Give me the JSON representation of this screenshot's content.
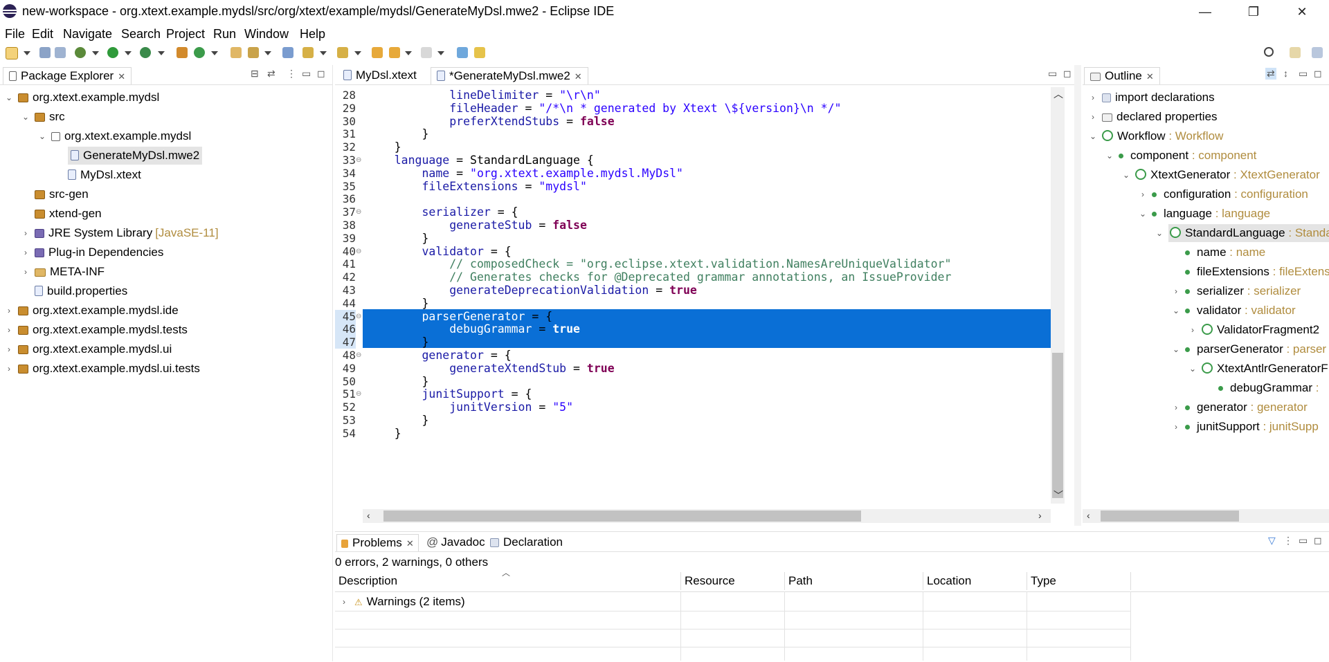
{
  "window": {
    "title": "new-workspace - org.xtext.example.mydsl/src/org/xtext/example/mydsl/GenerateMyDsl.mwe2 - Eclipse IDE",
    "minimize": "—",
    "restore": "❐",
    "close": "✕"
  },
  "menu": [
    "File",
    "Edit",
    "Navigate",
    "Search",
    "Project",
    "Run",
    "Window",
    "Help"
  ],
  "package_explorer": {
    "tab": "Package Explorer",
    "items": [
      {
        "label": "org.xtext.example.mydsl",
        "icon": "project-icon",
        "twisty": "⌄"
      },
      {
        "label": "src",
        "icon": "source-folder-icon",
        "twisty": "⌄"
      },
      {
        "label": "org.xtext.example.mydsl",
        "icon": "package-icon",
        "twisty": "⌄"
      },
      {
        "label": "GenerateMyDsl.mwe2",
        "icon": "mwe2-file-icon",
        "twisty": ""
      },
      {
        "label": "MyDsl.xtext",
        "icon": "xtext-file-icon",
        "twisty": ""
      },
      {
        "label": "src-gen",
        "icon": "source-folder-icon",
        "twisty": ""
      },
      {
        "label": "xtend-gen",
        "icon": "source-folder-icon",
        "twisty": ""
      },
      {
        "label": "JRE System Library",
        "suffix": "[JavaSE-11]",
        "icon": "library-icon",
        "twisty": "›"
      },
      {
        "label": "Plug-in Dependencies",
        "icon": "library-icon",
        "twisty": "›"
      },
      {
        "label": "META-INF",
        "icon": "folder-icon",
        "twisty": "›"
      },
      {
        "label": "build.properties",
        "icon": "properties-file-icon",
        "twisty": ""
      },
      {
        "label": "org.xtext.example.mydsl.ide",
        "icon": "project-icon",
        "twisty": "›"
      },
      {
        "label": "org.xtext.example.mydsl.tests",
        "icon": "project-icon",
        "twisty": "›"
      },
      {
        "label": "org.xtext.example.mydsl.ui",
        "icon": "project-icon",
        "twisty": "›"
      },
      {
        "label": "org.xtext.example.mydsl.ui.tests",
        "icon": "project-icon",
        "twisty": "›"
      }
    ]
  },
  "editor": {
    "tabs": [
      "MyDsl.xtext",
      "*GenerateMyDsl.mwe2"
    ],
    "lines": [
      {
        "n": "28",
        "text": "            lineDelimiter = \"\\r\\n\""
      },
      {
        "n": "29",
        "text": "            fileHeader = \"/*\\n * generated by Xtext \\${version}\\n */\""
      },
      {
        "n": "30",
        "text": "            preferXtendStubs = false"
      },
      {
        "n": "31",
        "text": "        }"
      },
      {
        "n": "32",
        "text": "    }"
      },
      {
        "n": "33",
        "text": "    language = StandardLanguage {"
      },
      {
        "n": "34",
        "text": "        name = \"org.xtext.example.mydsl.MyDsl\""
      },
      {
        "n": "35",
        "text": "        fileExtensions = \"mydsl\""
      },
      {
        "n": "36",
        "text": ""
      },
      {
        "n": "37",
        "text": "        serializer = {"
      },
      {
        "n": "38",
        "text": "            generateStub = false"
      },
      {
        "n": "39",
        "text": "        }"
      },
      {
        "n": "40",
        "text": "        validator = {"
      },
      {
        "n": "41",
        "text": "            // composedCheck = \"org.eclipse.xtext.validation.NamesAreUniqueValidator\""
      },
      {
        "n": "42",
        "text": "            // Generates checks for @Deprecated grammar annotations, an IssueProvider"
      },
      {
        "n": "43",
        "text": "            generateDeprecationValidation = true"
      },
      {
        "n": "44",
        "text": "        }"
      },
      {
        "n": "45",
        "text": "        parserGenerator = {"
      },
      {
        "n": "46",
        "text": "            debugGrammar = true"
      },
      {
        "n": "47",
        "text": "        }"
      },
      {
        "n": "48",
        "text": "        generator = {"
      },
      {
        "n": "49",
        "text": "            generateXtendStub = true"
      },
      {
        "n": "50",
        "text": "        }"
      },
      {
        "n": "51",
        "text": "        junitSupport = {"
      },
      {
        "n": "52",
        "text": "            junitVersion = \"5\""
      },
      {
        "n": "53",
        "text": "        }"
      },
      {
        "n": "54",
        "text": "    }"
      }
    ]
  },
  "outline": {
    "tab": "Outline",
    "items": [
      {
        "label": "import declarations",
        "type": "",
        "icon": "import-icon",
        "twisty": "›"
      },
      {
        "label": "declared properties",
        "type": "",
        "icon": "properties-icon",
        "twisty": "›"
      },
      {
        "label": "Workflow",
        "type": "Workflow",
        "icon": "component-icon",
        "twisty": "⌄"
      },
      {
        "label": "component",
        "type": "component",
        "icon": "property-dot-icon",
        "twisty": "⌄"
      },
      {
        "label": "XtextGenerator",
        "type": "XtextGenerator",
        "icon": "component-icon",
        "twisty": "⌄"
      },
      {
        "label": "configuration",
        "type": "configuration",
        "icon": "property-dot-icon",
        "twisty": "›"
      },
      {
        "label": "language",
        "type": "language",
        "icon": "property-dot-icon",
        "twisty": "⌄"
      },
      {
        "label": "StandardLanguage",
        "type": "Standa",
        "icon": "component-icon",
        "twisty": "⌄"
      },
      {
        "label": "name",
        "type": "name",
        "icon": "property-dot-icon",
        "twisty": ""
      },
      {
        "label": "fileExtensions",
        "type": "fileExtens",
        "icon": "property-dot-icon",
        "twisty": ""
      },
      {
        "label": "serializer",
        "type": "serializer",
        "icon": "property-dot-icon",
        "twisty": "›"
      },
      {
        "label": "validator",
        "type": "validator",
        "icon": "property-dot-icon",
        "twisty": "⌄"
      },
      {
        "label": "ValidatorFragment2",
        "type": "",
        "icon": "component-icon",
        "twisty": "›"
      },
      {
        "label": "parserGenerator",
        "type": "parser",
        "icon": "property-dot-icon",
        "twisty": "⌄"
      },
      {
        "label": "XtextAntlrGeneratorF",
        "type": "",
        "icon": "component-icon",
        "twisty": "⌄"
      },
      {
        "label": "debugGrammar",
        "type": ":",
        "icon": "property-dot-icon",
        "twisty": ""
      },
      {
        "label": "generator",
        "type": "generator",
        "icon": "property-dot-icon",
        "twisty": "›"
      },
      {
        "label": "junitSupport",
        "type": "junitSupp",
        "icon": "property-dot-icon",
        "twisty": "›"
      }
    ]
  },
  "problems": {
    "tabs": [
      "Problems",
      "Javadoc",
      "Declaration"
    ],
    "summary": "0 errors, 2 warnings, 0 others",
    "columns": [
      "Description",
      "Resource",
      "Path",
      "Location",
      "Type"
    ],
    "rows": [
      {
        "description": "Warnings (2 items)"
      }
    ]
  },
  "colors": {
    "selection": "#0a6fd6",
    "keyword": "#7f0055",
    "property": "#1a1aa6",
    "string": "#2a00ff",
    "comment": "#3f7f5f",
    "type_hint": "#b08c3e"
  }
}
